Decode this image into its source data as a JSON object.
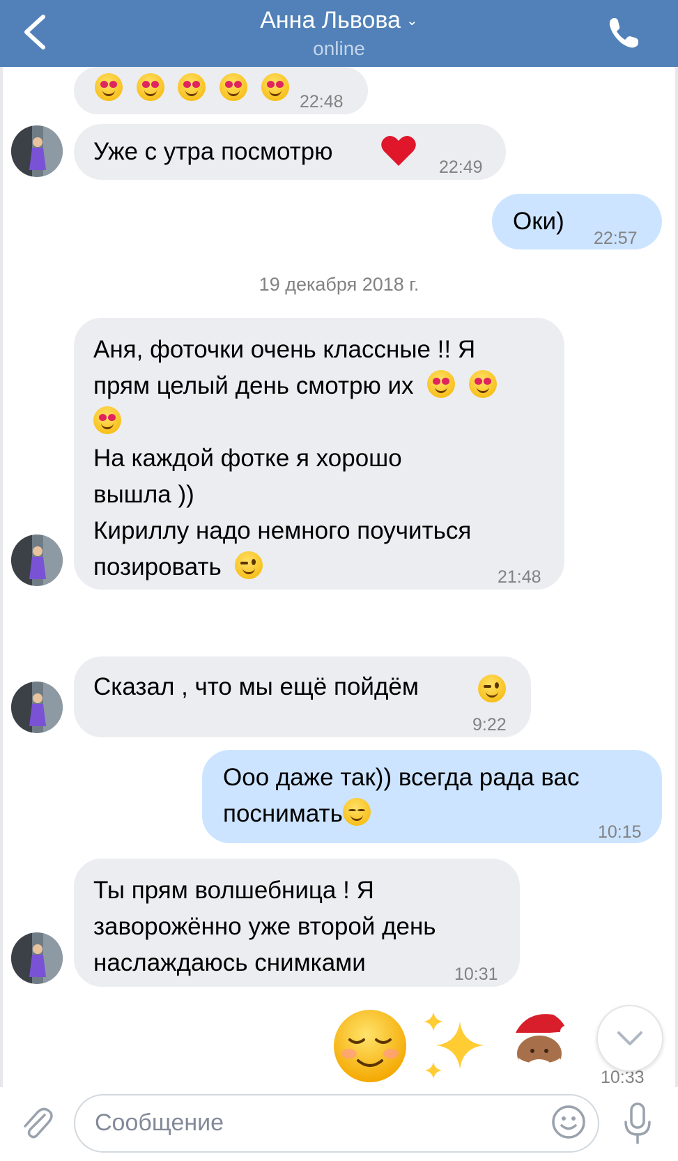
{
  "header": {
    "title": "Анна Львова",
    "status": "online",
    "back_icon": "chevron-left-icon",
    "dropdown_icon": "chevron-down-icon",
    "call_icon": "phone-icon"
  },
  "messages": [
    {
      "dir": "in",
      "text": "",
      "emoji": "smiling face with heart-eyes x5",
      "time": "22:48"
    },
    {
      "dir": "in",
      "text": "Уже с утра посмотрю",
      "emoji": "red heart",
      "time": "22:49"
    },
    {
      "dir": "out",
      "text": "Оки)",
      "time": "22:57"
    },
    {
      "dir": "in",
      "lines": [
        "Аня, фоточки очень классные !! Я",
        "прям целый день смотрю их",
        "",
        "На каждой фотке я хорошо",
        "вышла ))",
        "Кириллу надо немного поучиться",
        "позировать"
      ],
      "time": "21:48"
    },
    {
      "dir": "in",
      "text": "Сказал , что мы ещё пойдём",
      "emoji": "winking face",
      "time": "9:22"
    },
    {
      "dir": "out",
      "lines": [
        "Ооо даже так)) всегда рада вас",
        "поснимать"
      ],
      "emoji": "smiling face",
      "time": "10:15"
    },
    {
      "dir": "in",
      "lines": [
        "Ты прям волшебница ! Я",
        "заворожённо уже второй день",
        "наслаждаюсь снимками"
      ],
      "time": "10:31"
    },
    {
      "dir": "out",
      "text": "",
      "emoji": "smiling face, sparkles, Santa Claus",
      "time": "10:33"
    }
  ],
  "date_separator": "19 декабря 2018 г.",
  "composer": {
    "placeholder": "Сообщение",
    "attach_icon": "paperclip-icon",
    "emoji_icon": "smiley-icon",
    "mic_icon": "microphone-icon"
  },
  "scroll_down_icon": "chevron-down-icon",
  "colors": {
    "header": "#5181b8",
    "incoming": "#ebedf0",
    "outgoing": "#cce4ff",
    "time": "#828282"
  }
}
